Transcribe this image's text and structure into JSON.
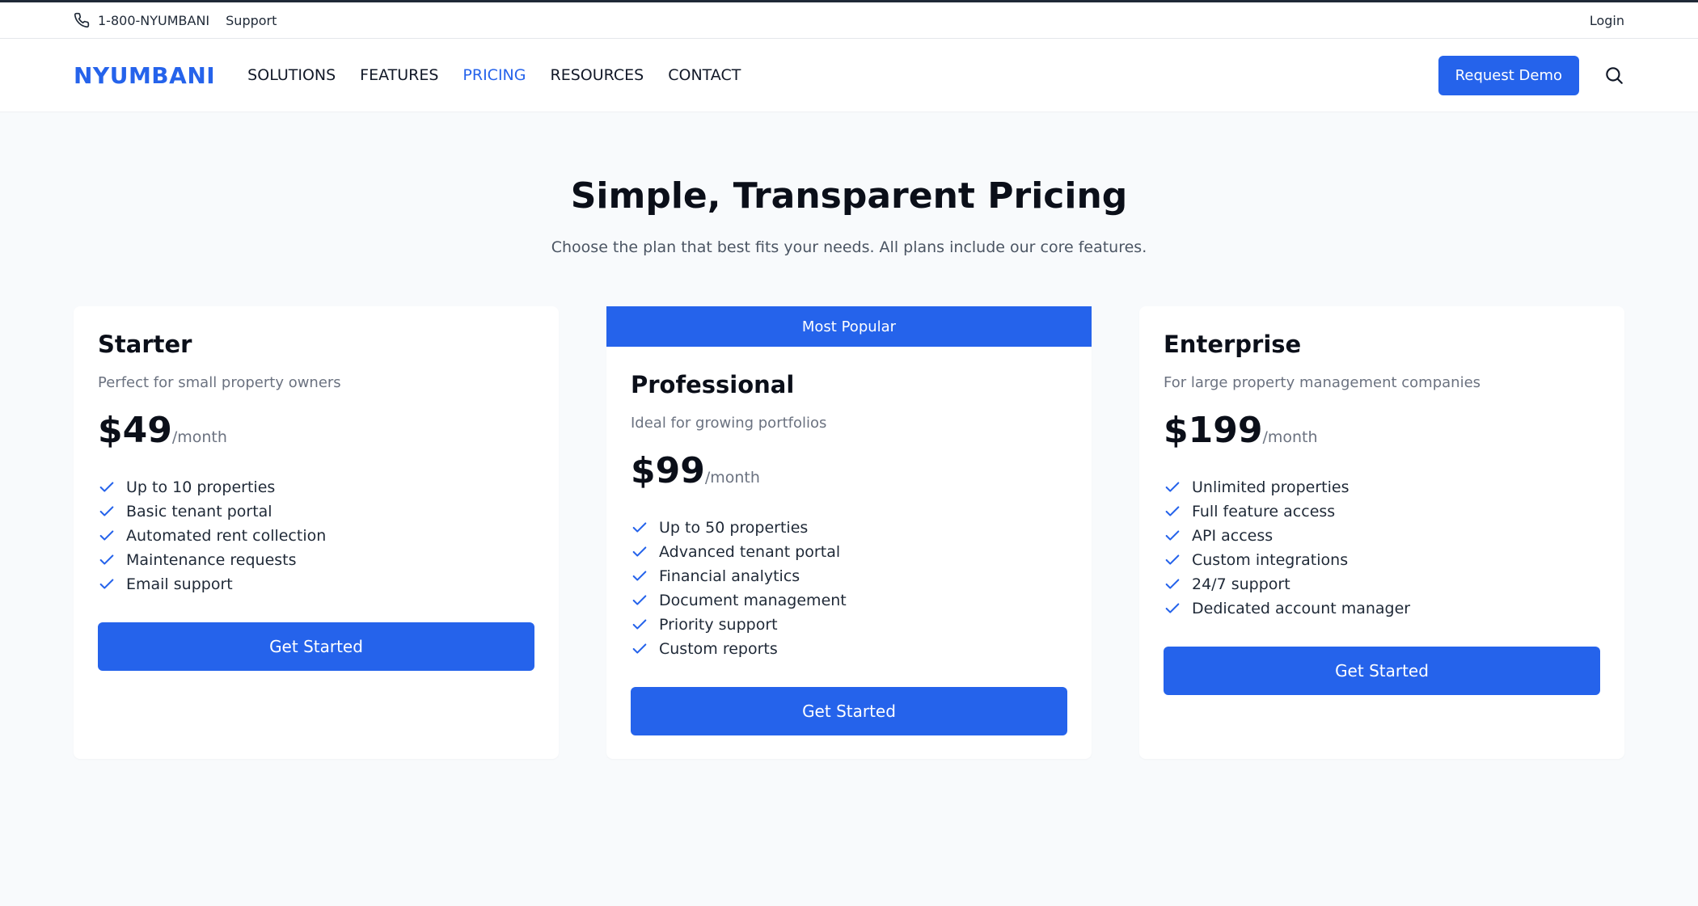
{
  "topbar": {
    "phone_icon": "phone-icon",
    "phone": "1-800-NYUMBANI",
    "support": "Support",
    "login": "Login"
  },
  "nav": {
    "brand": "NYUMBANI",
    "links": [
      {
        "label": "SOLUTIONS",
        "active": false
      },
      {
        "label": "FEATURES",
        "active": false
      },
      {
        "label": "PRICING",
        "active": true
      },
      {
        "label": "RESOURCES",
        "active": false
      },
      {
        "label": "CONTACT",
        "active": false
      }
    ],
    "demo_button": "Request Demo",
    "search_icon": "search-icon"
  },
  "hero": {
    "title": "Simple, Transparent Pricing",
    "subtitle": "Choose the plan that best fits your needs. All plans include our core features."
  },
  "plans": [
    {
      "name": "Starter",
      "description": "Perfect for small property owners",
      "price": "$49",
      "period": "/month",
      "features": [
        "Up to 10 properties",
        "Basic tenant portal",
        "Automated rent collection",
        "Maintenance requests",
        "Email support"
      ],
      "cta": "Get Started"
    },
    {
      "badge": "Most Popular",
      "name": "Professional",
      "description": "Ideal for growing portfolios",
      "price": "$99",
      "period": "/month",
      "features": [
        "Up to 50 properties",
        "Advanced tenant portal",
        "Financial analytics",
        "Document management",
        "Priority support",
        "Custom reports"
      ],
      "cta": "Get Started"
    },
    {
      "name": "Enterprise",
      "description": "For large property management companies",
      "price": "$199",
      "period": "/month",
      "features": [
        "Unlimited properties",
        "Full feature access",
        "API access",
        "Custom integrations",
        "24/7 support",
        "Dedicated account manager"
      ],
      "cta": "Get Started"
    }
  ],
  "colors": {
    "accent": "#2563eb",
    "page_bg": "#f8fafc"
  }
}
